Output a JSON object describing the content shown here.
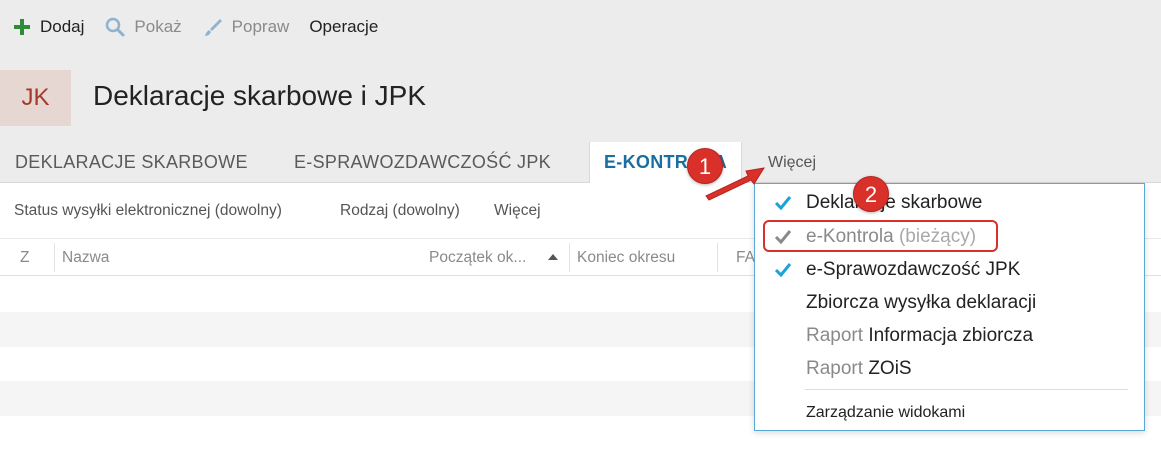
{
  "toolbar": {
    "add": "Dodaj",
    "show": "Pokaż",
    "edit": "Popraw",
    "operations": "Operacje"
  },
  "header": {
    "badge": "JK",
    "title": "Deklaracje skarbowe i JPK"
  },
  "tabs": {
    "items": [
      {
        "label": "DEKLARACJE SKARBOWE"
      },
      {
        "label": "E-SPRAWOZDAWCZOŚĆ JPK"
      },
      {
        "label": "E-KONTROLA"
      }
    ],
    "more": "Więcej"
  },
  "filters": {
    "status": "Status wysyłki elektronicznej (dowolny)",
    "kind": "Rodzaj (dowolny)",
    "more": "Więcej"
  },
  "table": {
    "columns": [
      "Z",
      "Nazwa",
      "Początek ok...",
      "Koniec okresu",
      "FA"
    ]
  },
  "menu": {
    "items": [
      {
        "label": "Deklaracje skarbowe",
        "checked": true
      },
      {
        "label": "e-Kontrola",
        "suffix": "(bieżący)",
        "checked": true
      },
      {
        "label": "e-Sprawozdawczość JPK",
        "checked": true
      },
      {
        "label": "Zbiorcza wysyłka deklaracji",
        "checked": false
      },
      {
        "prefix": "Raport",
        "label": "Informacja zbiorcza",
        "checked": false
      },
      {
        "prefix": "Raport",
        "label": "ZOiS",
        "checked": false
      }
    ],
    "manage": "Zarządzanie widokami"
  },
  "annotations": {
    "step1": "1",
    "step2": "2"
  },
  "colors": {
    "accent": "#1a6ea0",
    "check": "#1aa3d9",
    "highlight": "#d9302a",
    "add_icon": "#2e8b3a"
  }
}
